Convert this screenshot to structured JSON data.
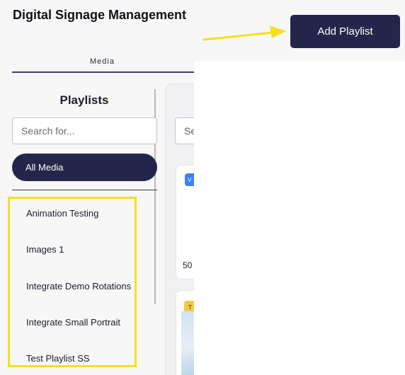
{
  "header": {
    "title": "Digital Signage Management",
    "add_playlist_label": "Add Playlist"
  },
  "tabs": [
    {
      "label": "Media",
      "active": true
    }
  ],
  "sidebar": {
    "heading": "Playlists",
    "search_placeholder": "Search for...",
    "all_media_label": "All Media",
    "playlists": [
      {
        "label": "Animation Testing"
      },
      {
        "label": "Images 1"
      },
      {
        "label": "Integrate Demo Rotations"
      },
      {
        "label": "Integrate Small Portrait"
      },
      {
        "label": "Test Playlist SS"
      }
    ]
  },
  "content": {
    "search_partial": "Se",
    "card_badge_1": "V",
    "card_count_1": "50",
    "card_badge_2": "T"
  },
  "colors": {
    "primary": "#24254a",
    "annotation_yellow": "#f5df1f",
    "badge_blue": "#3b82f6",
    "badge_yellow": "#f6c945"
  },
  "annotations": {
    "arrow": "arrow-right-icon",
    "highlight": "highlight-box"
  }
}
